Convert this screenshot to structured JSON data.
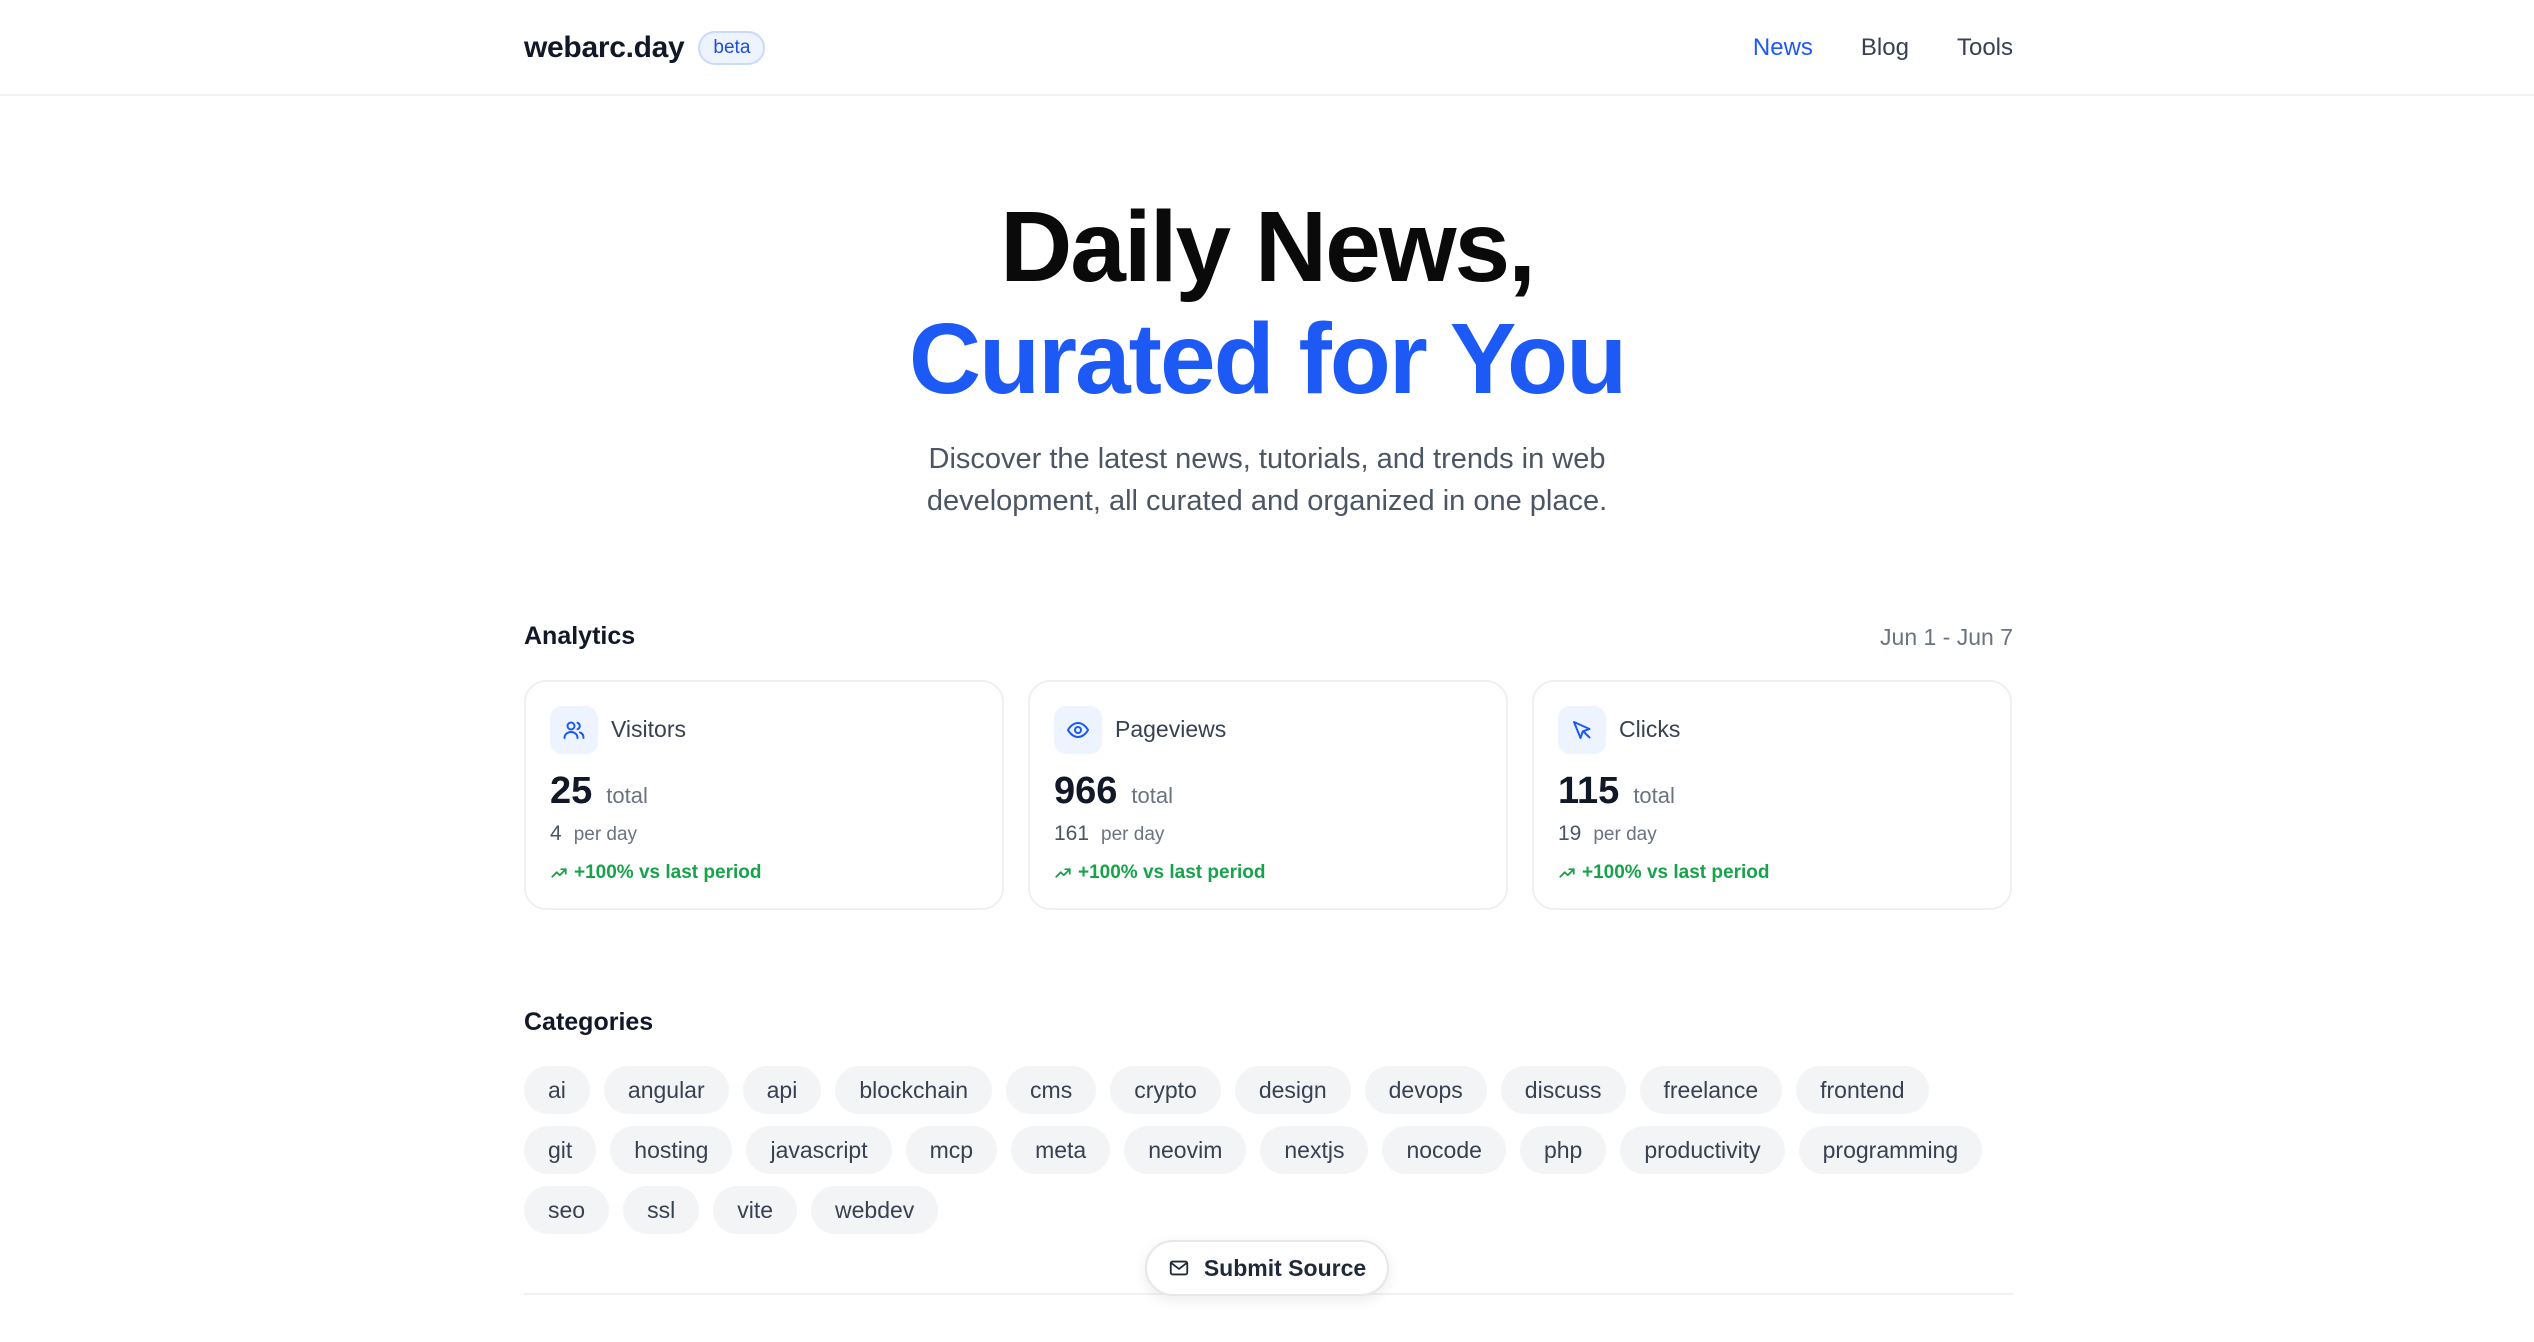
{
  "header": {
    "brand": "webarc.day",
    "badge": "beta",
    "nav": [
      {
        "label": "News",
        "active": true
      },
      {
        "label": "Blog",
        "active": false
      },
      {
        "label": "Tools",
        "active": false
      }
    ]
  },
  "hero": {
    "line1": "Daily News,",
    "line2": "Curated for You",
    "subtitle_line1": "Discover the latest news, tutorials, and trends in web",
    "subtitle_line2": "development, all curated and organized in one place."
  },
  "analytics": {
    "title": "Analytics",
    "date_range": "Jun 1 - Jun 7",
    "cards": [
      {
        "label": "Visitors",
        "icon": "users-icon",
        "total": "25",
        "total_unit": "total",
        "per_day": "4",
        "per_day_unit": "per day",
        "trend": "+100% vs last period"
      },
      {
        "label": "Pageviews",
        "icon": "eye-icon",
        "total": "966",
        "total_unit": "total",
        "per_day": "161",
        "per_day_unit": "per day",
        "trend": "+100% vs last period"
      },
      {
        "label": "Clicks",
        "icon": "cursor-icon",
        "total": "115",
        "total_unit": "total",
        "per_day": "19",
        "per_day_unit": "per day",
        "trend": "+100% vs last period"
      }
    ]
  },
  "categories": {
    "title": "Categories",
    "items": [
      "ai",
      "angular",
      "api",
      "blockchain",
      "cms",
      "crypto",
      "design",
      "devops",
      "discuss",
      "freelance",
      "frontend",
      "git",
      "hosting",
      "javascript",
      "mcp",
      "meta",
      "neovim",
      "nextjs",
      "nocode",
      "php",
      "productivity",
      "programming",
      "seo",
      "ssl",
      "vite",
      "webdev"
    ]
  },
  "submit": {
    "label": "Submit Source",
    "icon": "mail-icon"
  },
  "colors": {
    "accent": "#1d5af5",
    "trend": "#16a34a",
    "chip_bg": "#f3f4f6"
  }
}
